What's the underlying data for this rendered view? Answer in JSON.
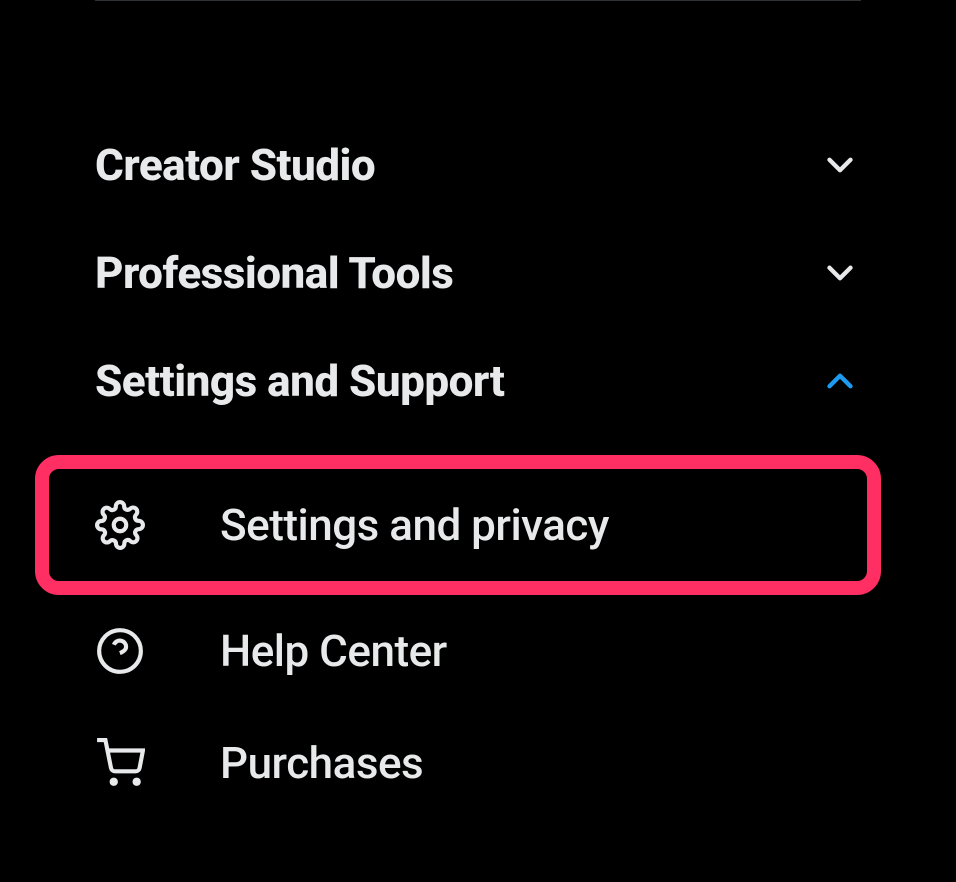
{
  "menu": {
    "sections": [
      {
        "label": "Creator Studio",
        "expanded": false
      },
      {
        "label": "Professional Tools",
        "expanded": false
      },
      {
        "label": "Settings and Support",
        "expanded": true,
        "items": [
          {
            "label": "Settings and privacy",
            "icon": "gear",
            "highlighted": true
          },
          {
            "label": "Help Center",
            "icon": "help"
          },
          {
            "label": "Purchases",
            "icon": "cart"
          }
        ]
      }
    ]
  }
}
